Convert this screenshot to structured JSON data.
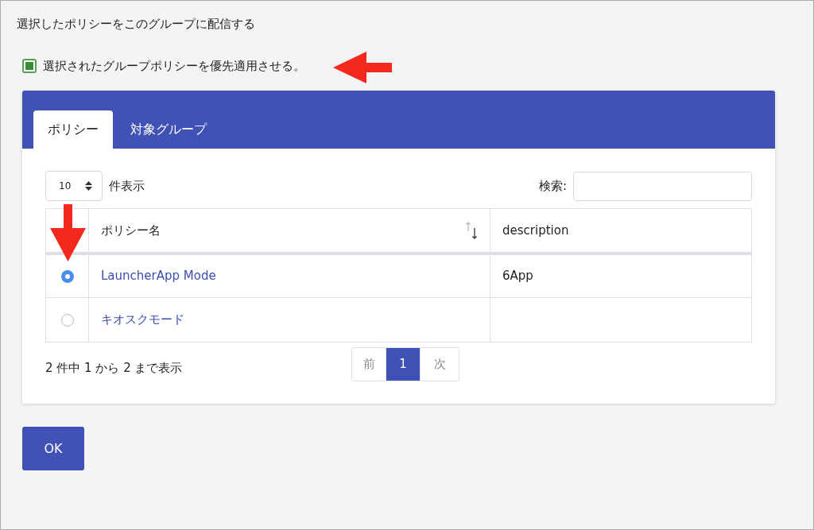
{
  "title": "選択したポリシーをこのグループに配信する",
  "priority_checkbox": {
    "label": "選択されたグループポリシーを優先適用させる。",
    "checked": true
  },
  "tabs": [
    {
      "label": "ポリシー",
      "selected": true
    },
    {
      "label": "対象グループ",
      "selected": false
    }
  ],
  "length_select": {
    "value": "10",
    "suffix": "件表示"
  },
  "search": {
    "label": "検索:"
  },
  "table": {
    "columns": [
      "ポリシー名",
      "description"
    ],
    "rows": [
      {
        "selected": true,
        "name": "LauncherApp Mode",
        "description": "6App"
      },
      {
        "selected": false,
        "name": "キオスクモード",
        "description": ""
      }
    ]
  },
  "info": "2 件中 1 から 2 まで表示",
  "pagination": [
    {
      "label": "前",
      "selected": false
    },
    {
      "label": "1",
      "selected": true
    },
    {
      "label": "次",
      "selected": false
    }
  ],
  "ok_button": "OK"
}
